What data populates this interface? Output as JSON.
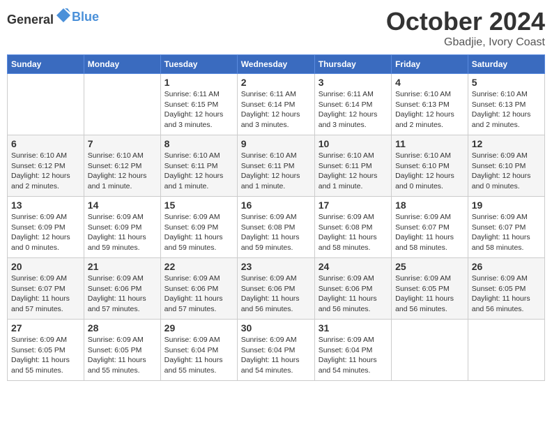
{
  "header": {
    "logo_general": "General",
    "logo_blue": "Blue",
    "month": "October 2024",
    "location": "Gbadjie, Ivory Coast"
  },
  "weekdays": [
    "Sunday",
    "Monday",
    "Tuesday",
    "Wednesday",
    "Thursday",
    "Friday",
    "Saturday"
  ],
  "weeks": [
    [
      {
        "day": "",
        "info": ""
      },
      {
        "day": "",
        "info": ""
      },
      {
        "day": "1",
        "info": "Sunrise: 6:11 AM\nSunset: 6:15 PM\nDaylight: 12 hours\nand 3 minutes."
      },
      {
        "day": "2",
        "info": "Sunrise: 6:11 AM\nSunset: 6:14 PM\nDaylight: 12 hours\nand 3 minutes."
      },
      {
        "day": "3",
        "info": "Sunrise: 6:11 AM\nSunset: 6:14 PM\nDaylight: 12 hours\nand 3 minutes."
      },
      {
        "day": "4",
        "info": "Sunrise: 6:10 AM\nSunset: 6:13 PM\nDaylight: 12 hours\nand 2 minutes."
      },
      {
        "day": "5",
        "info": "Sunrise: 6:10 AM\nSunset: 6:13 PM\nDaylight: 12 hours\nand 2 minutes."
      }
    ],
    [
      {
        "day": "6",
        "info": "Sunrise: 6:10 AM\nSunset: 6:12 PM\nDaylight: 12 hours\nand 2 minutes."
      },
      {
        "day": "7",
        "info": "Sunrise: 6:10 AM\nSunset: 6:12 PM\nDaylight: 12 hours\nand 1 minute."
      },
      {
        "day": "8",
        "info": "Sunrise: 6:10 AM\nSunset: 6:11 PM\nDaylight: 12 hours\nand 1 minute."
      },
      {
        "day": "9",
        "info": "Sunrise: 6:10 AM\nSunset: 6:11 PM\nDaylight: 12 hours\nand 1 minute."
      },
      {
        "day": "10",
        "info": "Sunrise: 6:10 AM\nSunset: 6:11 PM\nDaylight: 12 hours\nand 1 minute."
      },
      {
        "day": "11",
        "info": "Sunrise: 6:10 AM\nSunset: 6:10 PM\nDaylight: 12 hours\nand 0 minutes."
      },
      {
        "day": "12",
        "info": "Sunrise: 6:09 AM\nSunset: 6:10 PM\nDaylight: 12 hours\nand 0 minutes."
      }
    ],
    [
      {
        "day": "13",
        "info": "Sunrise: 6:09 AM\nSunset: 6:09 PM\nDaylight: 12 hours\nand 0 minutes."
      },
      {
        "day": "14",
        "info": "Sunrise: 6:09 AM\nSunset: 6:09 PM\nDaylight: 11 hours\nand 59 minutes."
      },
      {
        "day": "15",
        "info": "Sunrise: 6:09 AM\nSunset: 6:09 PM\nDaylight: 11 hours\nand 59 minutes."
      },
      {
        "day": "16",
        "info": "Sunrise: 6:09 AM\nSunset: 6:08 PM\nDaylight: 11 hours\nand 59 minutes."
      },
      {
        "day": "17",
        "info": "Sunrise: 6:09 AM\nSunset: 6:08 PM\nDaylight: 11 hours\nand 58 minutes."
      },
      {
        "day": "18",
        "info": "Sunrise: 6:09 AM\nSunset: 6:07 PM\nDaylight: 11 hours\nand 58 minutes."
      },
      {
        "day": "19",
        "info": "Sunrise: 6:09 AM\nSunset: 6:07 PM\nDaylight: 11 hours\nand 58 minutes."
      }
    ],
    [
      {
        "day": "20",
        "info": "Sunrise: 6:09 AM\nSunset: 6:07 PM\nDaylight: 11 hours\nand 57 minutes."
      },
      {
        "day": "21",
        "info": "Sunrise: 6:09 AM\nSunset: 6:06 PM\nDaylight: 11 hours\nand 57 minutes."
      },
      {
        "day": "22",
        "info": "Sunrise: 6:09 AM\nSunset: 6:06 PM\nDaylight: 11 hours\nand 57 minutes."
      },
      {
        "day": "23",
        "info": "Sunrise: 6:09 AM\nSunset: 6:06 PM\nDaylight: 11 hours\nand 56 minutes."
      },
      {
        "day": "24",
        "info": "Sunrise: 6:09 AM\nSunset: 6:06 PM\nDaylight: 11 hours\nand 56 minutes."
      },
      {
        "day": "25",
        "info": "Sunrise: 6:09 AM\nSunset: 6:05 PM\nDaylight: 11 hours\nand 56 minutes."
      },
      {
        "day": "26",
        "info": "Sunrise: 6:09 AM\nSunset: 6:05 PM\nDaylight: 11 hours\nand 56 minutes."
      }
    ],
    [
      {
        "day": "27",
        "info": "Sunrise: 6:09 AM\nSunset: 6:05 PM\nDaylight: 11 hours\nand 55 minutes."
      },
      {
        "day": "28",
        "info": "Sunrise: 6:09 AM\nSunset: 6:05 PM\nDaylight: 11 hours\nand 55 minutes."
      },
      {
        "day": "29",
        "info": "Sunrise: 6:09 AM\nSunset: 6:04 PM\nDaylight: 11 hours\nand 55 minutes."
      },
      {
        "day": "30",
        "info": "Sunrise: 6:09 AM\nSunset: 6:04 PM\nDaylight: 11 hours\nand 54 minutes."
      },
      {
        "day": "31",
        "info": "Sunrise: 6:09 AM\nSunset: 6:04 PM\nDaylight: 11 hours\nand 54 minutes."
      },
      {
        "day": "",
        "info": ""
      },
      {
        "day": "",
        "info": ""
      }
    ]
  ]
}
